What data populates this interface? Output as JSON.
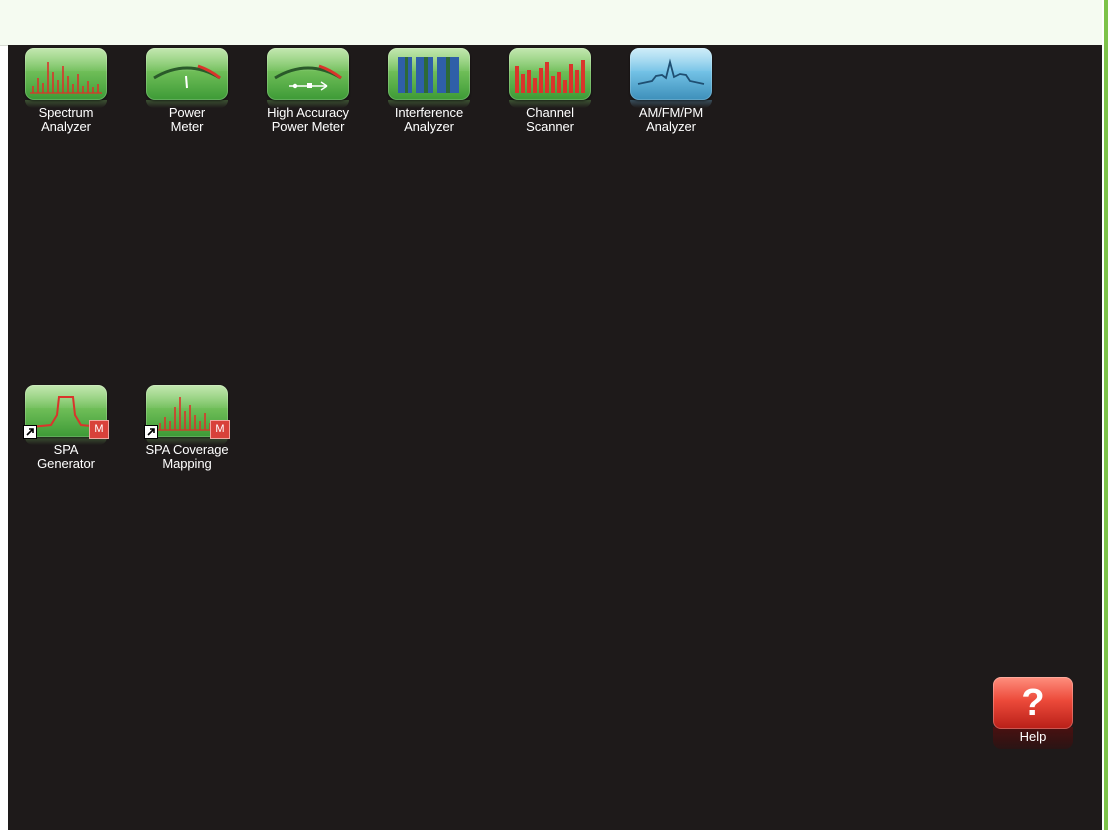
{
  "apps": [
    {
      "id": "spectrum-analyzer",
      "icon": "spectrum-bars-icon",
      "label_lines": [
        "Spectrum",
        "Analyzer"
      ]
    },
    {
      "id": "power-meter",
      "icon": "power-gauge-icon",
      "label_lines": [
        "Power",
        "Meter"
      ]
    },
    {
      "id": "high-accuracy-power-meter",
      "icon": "usb-power-gauge-icon",
      "label_lines": [
        "High Accuracy",
        "Power Meter"
      ]
    },
    {
      "id": "interference-analyzer",
      "icon": "spectrogram-bars-icon",
      "label_lines": [
        "Interference",
        "Analyzer"
      ]
    },
    {
      "id": "channel-scanner",
      "icon": "channel-bars-icon",
      "label_lines": [
        "Channel",
        "Scanner"
      ]
    },
    {
      "id": "am-fm-pm-analyzer",
      "icon": "modulation-waveform-icon",
      "label_lines": [
        "AM/FM/PM",
        "Analyzer"
      ]
    },
    {
      "id": "spa-generator",
      "icon": "pulse-trace-icon",
      "label_lines": [
        "SPA",
        "Generator"
      ],
      "badge": "M"
    },
    {
      "id": "spa-coverage-mapping",
      "icon": "coverage-spectrum-icon",
      "label_lines": [
        "SPA Coverage",
        "Mapping"
      ],
      "badge": "M"
    }
  ],
  "help": {
    "symbol": "?",
    "label": "Help"
  },
  "colors": {
    "desktop_bg": "#1e1a1a",
    "top_bar_bg": "#f5fbf1",
    "accent_green": "#7dc24a",
    "tile_green": "#6fbe58",
    "tile_blue": "#73c2e6",
    "help_red": "#ec4a3a",
    "badge_red": "#d8413a"
  }
}
